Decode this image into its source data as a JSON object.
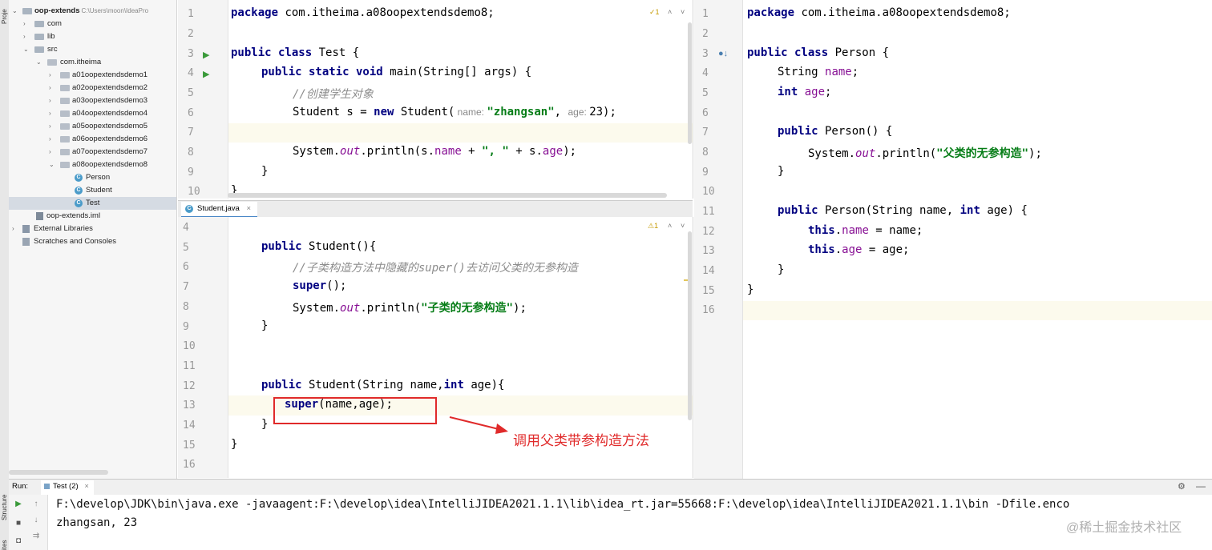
{
  "toolstrip": {
    "project_label": "Proje",
    "structure_label": "Structure",
    "favorites_label": "ites"
  },
  "project": {
    "rows": [
      {
        "name": "oop-extends",
        "path": "C:\\Users\\moon\\IdeaPro",
        "bold": true
      },
      {
        "name": "com"
      },
      {
        "name": "lib"
      },
      {
        "name": "src"
      },
      {
        "name": "com.itheima"
      },
      {
        "name": "a01oopextendsdemo1"
      },
      {
        "name": "a02oopextendsdemo2"
      },
      {
        "name": "a03oopextendsdemo3"
      },
      {
        "name": "a04oopextendsdemo4"
      },
      {
        "name": "a05oopextendsdemo5"
      },
      {
        "name": "a06oopextendsdemo6"
      },
      {
        "name": "a07oopextendsdemo7"
      },
      {
        "name": "a08oopextendsdemo8"
      },
      {
        "name": "Person"
      },
      {
        "name": "Student"
      },
      {
        "name": "Test"
      },
      {
        "name": "oop-extends.iml"
      },
      {
        "name": "External Libraries"
      },
      {
        "name": "Scratches and Consoles"
      }
    ]
  },
  "test_editor": {
    "line_numbers": [
      "1",
      "2",
      "3",
      "4",
      "5",
      "6",
      "7",
      "8",
      "9",
      "10"
    ],
    "l1_kw": "package",
    "l1_rest": " com.itheima.a08oopextendsdemo8;",
    "l3_kw": "public class",
    "l3_rest": " Test {",
    "l4_kw": "public static void",
    "l4_rest": " main(String[] args) {",
    "l5_comment": "//创建学生对象",
    "l6_a": "Student s = ",
    "l6_kw": "new",
    "l6_b": " Student(",
    "l6_hint1": " name: ",
    "l6_str": "\"zhangsan\"",
    "l6_c": ", ",
    "l6_hint2": "age: ",
    "l6_d": "23);",
    "l8_a": "System.",
    "l8_out": "out",
    "l8_b": ".println(s.",
    "l8_f1": "name",
    "l8_c": " + ",
    "l8_str": "\", \"",
    "l8_d": " + s.",
    "l8_f2": "age",
    "l8_e": ");",
    "l9": "}",
    "l10": "}",
    "warn": "1"
  },
  "student_tab": {
    "label": "Student.java",
    "close": "×"
  },
  "student_editor": {
    "line_numbers": [
      "4",
      "5",
      "6",
      "7",
      "8",
      "9",
      "10",
      "11",
      "12",
      "13",
      "14",
      "15",
      "16"
    ],
    "l5_kw": "public",
    "l5_rest": " Student(){",
    "l6_comment": "//子类构造方法中隐藏的super()去访问父类的无参构造",
    "l7_kw": "super",
    "l7_rest": "();",
    "l8_a": "System.",
    "l8_out": "out",
    "l8_b": ".println(",
    "l8_str": "\"子类的无参构造\"",
    "l8_c": ");",
    "l9": "}",
    "l12_kw1": "public",
    "l12_a": " Student(String name,",
    "l12_kw2": "int",
    "l12_b": " age){",
    "l13_kw": "super",
    "l13_rest": "(name,age);",
    "l14": "}",
    "l15": "}",
    "warn": "1"
  },
  "person_editor": {
    "line_numbers": [
      "1",
      "2",
      "3",
      "4",
      "5",
      "6",
      "7",
      "8",
      "9",
      "10",
      "11",
      "12",
      "13",
      "14",
      "15",
      "16"
    ],
    "l1_kw": "package",
    "l1_rest": " com.itheima.a08oopextendsdemo8;",
    "l3_kw": "public class",
    "l3_rest": " Person {",
    "l4_a": "String ",
    "l4_f": "name",
    "l4_b": ";",
    "l5_kw": "int",
    "l5_a": " ",
    "l5_f": "age",
    "l5_b": ";",
    "l7_kw": "public",
    "l7_rest": " Person() {",
    "l8_a": "System.",
    "l8_out": "out",
    "l8_b": ".println(",
    "l8_str": "\"父类的无参构造\"",
    "l8_c": ");",
    "l9": "}",
    "l11_kw1": "public",
    "l11_a": " Person(String name, ",
    "l11_kw2": "int",
    "l11_b": " age) {",
    "l12_kw": "this",
    "l12_a": ".",
    "l12_f": "name",
    "l12_b": " = name;",
    "l13_kw": "this",
    "l13_a": ".",
    "l13_f": "age",
    "l13_b": " = age;",
    "l14": "}",
    "l15": "}"
  },
  "run": {
    "label": "Run:",
    "tab": "Test (2)",
    "tab_close": "×",
    "cmd": "F:\\develop\\JDK\\bin\\java.exe -javaagent:F:\\develop\\idea\\IntelliJIDEA2021.1.1\\lib\\idea_rt.jar=55668:F:\\develop\\idea\\IntelliJIDEA2021.1.1\\bin -Dfile.enco",
    "output": "zhangsan, 23"
  },
  "annotation": {
    "text": "调用父类带参构造方法"
  },
  "watermark": "@稀土掘金技术社区",
  "colors": {
    "keyword": "#000080",
    "string": "#067d17",
    "field": "#871094",
    "comment": "#8c8c8c",
    "annotation": "#e02a2a"
  }
}
